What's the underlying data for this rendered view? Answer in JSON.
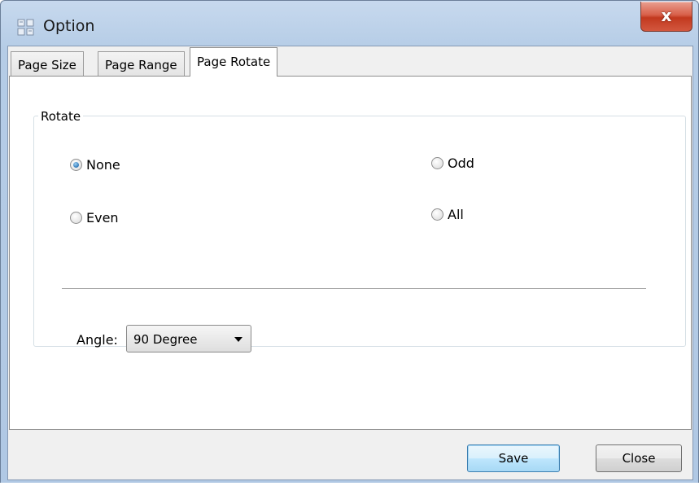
{
  "window": {
    "title": "Option",
    "close_label": "x"
  },
  "tabs": [
    {
      "label": "Page Size",
      "active": false
    },
    {
      "label": "Page Range",
      "active": false
    },
    {
      "label": "Page Rotate",
      "active": true
    }
  ],
  "rotate_group": {
    "label": "Rotate",
    "options": [
      {
        "label": "None",
        "checked": true
      },
      {
        "label": "Odd",
        "checked": false
      },
      {
        "label": "Even",
        "checked": false
      },
      {
        "label": "All",
        "checked": false
      }
    ]
  },
  "angle": {
    "label": "Angle:",
    "selected": "90 Degree"
  },
  "buttons": {
    "save": "Save",
    "close": "Close"
  },
  "colors": {
    "titlebar": "#b5cce6",
    "close_button": "#c2391f",
    "radio_checked": "#2f78b9",
    "default_button_border": "#3c7fb1"
  },
  "icons": {
    "app": "grid-app-icon",
    "close": "close-icon",
    "dropdown": "chevron-down-icon"
  }
}
